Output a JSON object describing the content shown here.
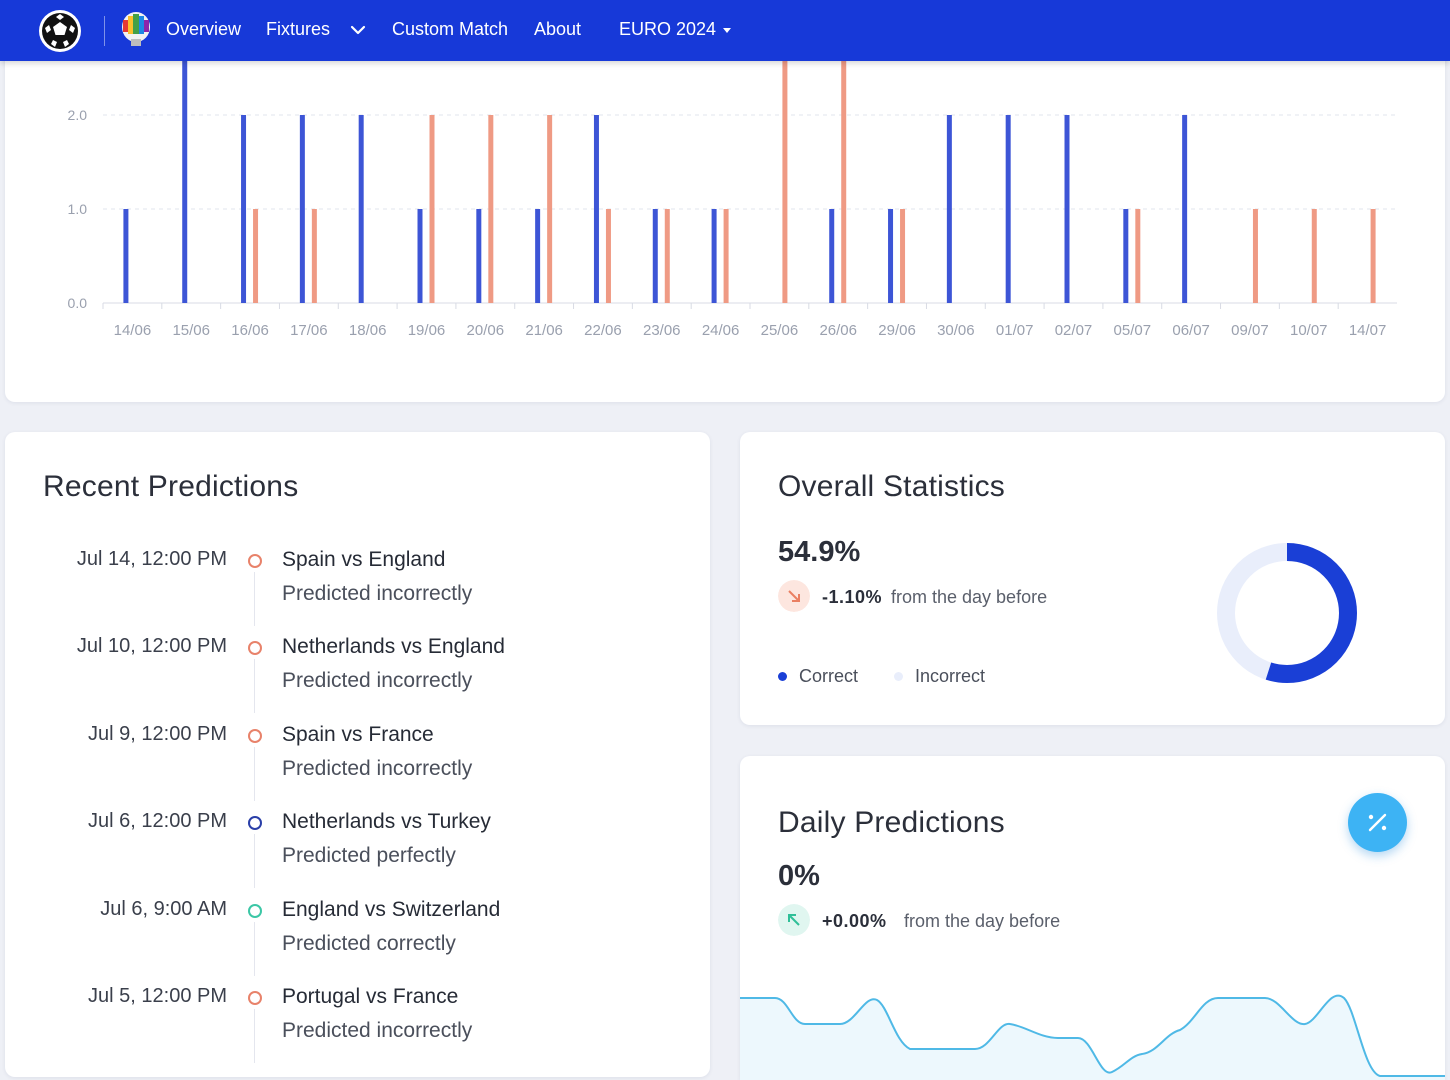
{
  "nav": {
    "items": [
      "Overview",
      "Fixtures",
      "Custom Match",
      "About"
    ],
    "tournament": "EURO 2024"
  },
  "colors": {
    "nav_bg": "#1739d8",
    "correct": "#3d55d6",
    "incorrect": "#ef9a84",
    "accent_blue": "#1a3fd6",
    "fab": "#3db3f4",
    "line": "#4fb9e6"
  },
  "chart_data": {
    "type": "bar",
    "categories": [
      "14/06",
      "15/06",
      "16/06",
      "17/06",
      "18/06",
      "19/06",
      "20/06",
      "21/06",
      "22/06",
      "23/06",
      "24/06",
      "25/06",
      "26/06",
      "29/06",
      "30/06",
      "01/07",
      "02/07",
      "05/07",
      "06/07",
      "09/07",
      "10/07",
      "14/07"
    ],
    "series": [
      {
        "name": "Correct",
        "values": [
          1,
          3,
          2,
          2,
          2,
          1,
          1,
          1,
          2,
          1,
          1,
          0,
          1,
          1,
          2,
          2,
          2,
          1,
          2,
          0,
          0,
          0
        ]
      },
      {
        "name": "Incorrect",
        "values": [
          0,
          0,
          1,
          1,
          0,
          2,
          2,
          2,
          1,
          1,
          1,
          3,
          3,
          1,
          0,
          0,
          0,
          1,
          0,
          1,
          1,
          1
        ]
      }
    ],
    "yticks": [
      "0.0",
      "1.0",
      "2.0"
    ],
    "ylim": [
      0,
      2.5
    ],
    "grid": true
  },
  "recent": {
    "title": "Recent Predictions",
    "items": [
      {
        "date": "Jul 14, 12:00 PM",
        "match": "Spain vs England",
        "status": "Predicted incorrectly",
        "color": "#e8826a"
      },
      {
        "date": "Jul 10, 12:00 PM",
        "match": "Netherlands vs England",
        "status": "Predicted incorrectly",
        "color": "#e8826a"
      },
      {
        "date": "Jul 9, 12:00 PM",
        "match": "Spain vs France",
        "status": "Predicted incorrectly",
        "color": "#e8826a"
      },
      {
        "date": "Jul 6, 12:00 PM",
        "match": "Netherlands vs Turkey",
        "status": "Predicted perfectly",
        "color": "#2a3fa8"
      },
      {
        "date": "Jul 6, 9:00 AM",
        "match": "England vs Switzerland",
        "status": "Predicted correctly",
        "color": "#3cc7a6"
      },
      {
        "date": "Jul 5, 12:00 PM",
        "match": "Portugal vs France",
        "status": "Predicted incorrectly",
        "color": "#e8826a"
      }
    ]
  },
  "overall": {
    "title": "Overall Statistics",
    "value": "54.9%",
    "change": "-1.10%",
    "change_text": "from the day before",
    "legend": [
      "Correct",
      "Incorrect"
    ],
    "donut_fraction": 0.549
  },
  "daily": {
    "title": "Daily Predictions",
    "value": "0%",
    "change": "+0.00%",
    "change_text": "from the day before"
  }
}
